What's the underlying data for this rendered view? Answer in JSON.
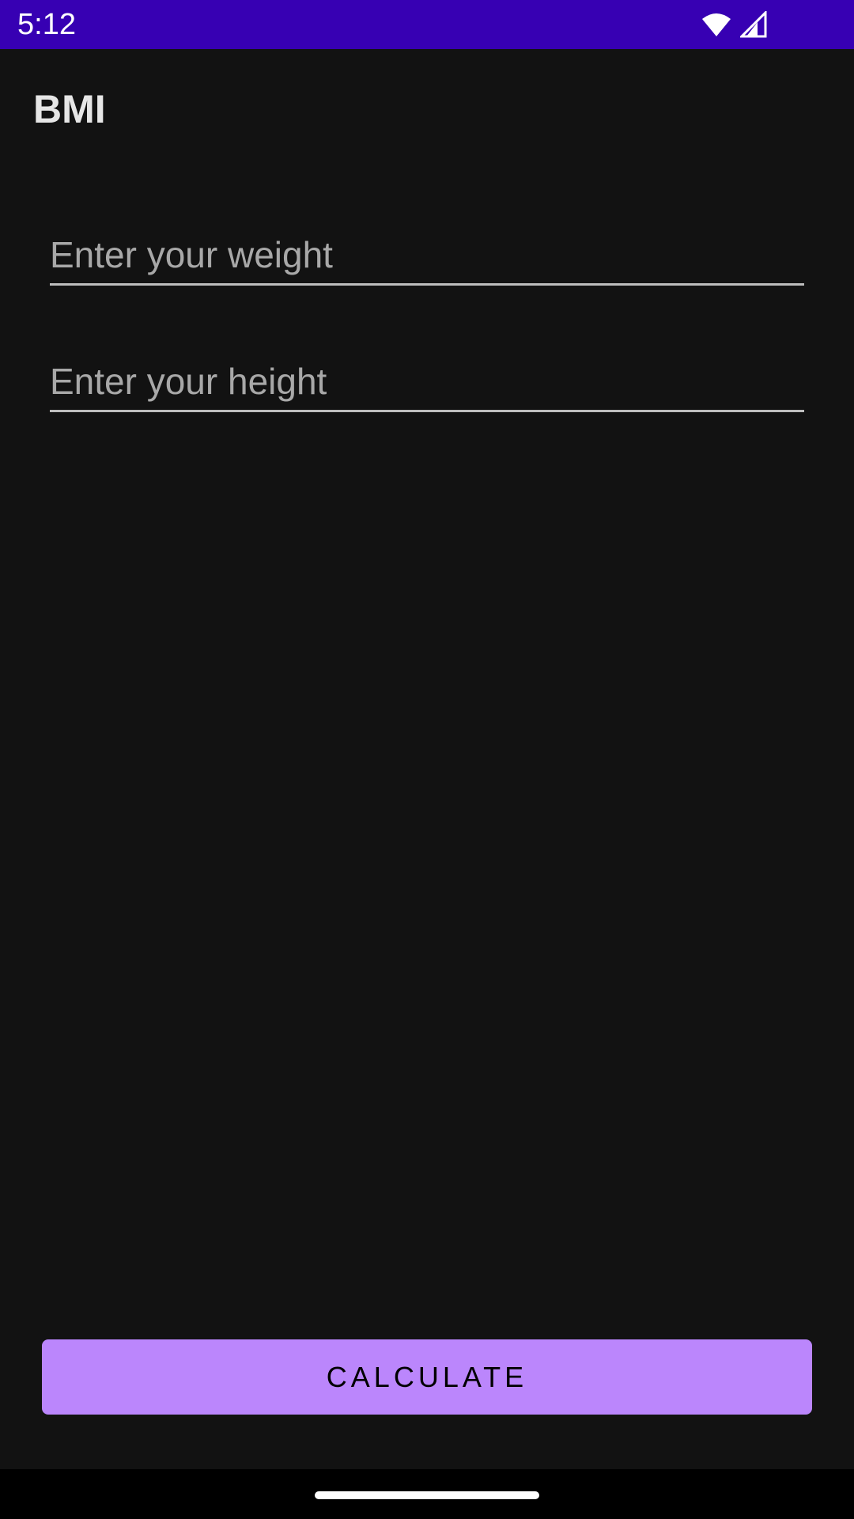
{
  "status_bar": {
    "time": "5:12",
    "icons": [
      "wifi-icon",
      "signal-icon"
    ],
    "color": "#3700b3"
  },
  "app": {
    "title": "BMI"
  },
  "form": {
    "weight_placeholder": "Enter your weight",
    "weight_value": "",
    "height_placeholder": "Enter your height",
    "height_value": ""
  },
  "actions": {
    "calculate_label": "CALCULATE",
    "accent_color": "#bb86fc"
  },
  "theme": {
    "background": "#121212"
  }
}
